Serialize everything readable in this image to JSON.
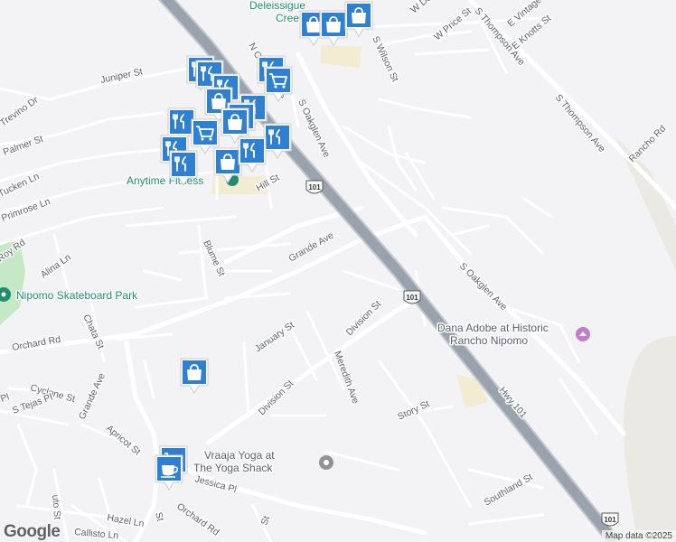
{
  "streets": [
    {
      "id": "n-oakglen",
      "text": "N Oakglen Ave"
    },
    {
      "id": "juniper",
      "text": "Juniper St"
    },
    {
      "id": "trevino",
      "text": "Trevino Dr"
    },
    {
      "id": "palmer",
      "text": "Palmer St"
    },
    {
      "id": "tucken",
      "text": "Tucken Ln"
    },
    {
      "id": "primrose",
      "text": "Primrose Ln"
    },
    {
      "id": "roy",
      "text": "Roy Rd"
    },
    {
      "id": "alina",
      "text": "Alina Ln"
    },
    {
      "id": "blume",
      "text": "Blume St"
    },
    {
      "id": "grande-ave",
      "text": "Grande Ave"
    },
    {
      "id": "hill",
      "text": "Hill St"
    },
    {
      "id": "s-oakglen-top",
      "text": "S Oakglen Ave"
    },
    {
      "id": "s-oakglen-bottom",
      "text": "S Oakglen Ave"
    },
    {
      "id": "orchard",
      "text": "Orchard Rd"
    },
    {
      "id": "orchard-bottom",
      "text": "Orchard Rd"
    },
    {
      "id": "chata",
      "text": "Chata St"
    },
    {
      "id": "january",
      "text": "January St"
    },
    {
      "id": "division-1",
      "text": "Division St"
    },
    {
      "id": "division-2",
      "text": "Division St"
    },
    {
      "id": "meredith",
      "text": "Meredith Ave"
    },
    {
      "id": "story",
      "text": "Story St"
    },
    {
      "id": "cyclone",
      "text": "Cyclone St"
    },
    {
      "id": "s-tejas",
      "text": "S Tejas Pl"
    },
    {
      "id": "grande-sw",
      "text": "Grande Ave"
    },
    {
      "id": "apricot",
      "text": "Apricot St"
    },
    {
      "id": "jessica",
      "text": "Jessica Pl"
    },
    {
      "id": "hazel",
      "text": "Hazel Ln"
    },
    {
      "id": "callisto",
      "text": "Callisto Ln"
    },
    {
      "id": "southland",
      "text": "Southland St"
    },
    {
      "id": "hwy-101",
      "text": "Hwy 101"
    },
    {
      "id": "s-thompson-1",
      "text": "S Thompson Ave"
    },
    {
      "id": "s-thompson-2",
      "text": "S Thompson Ave"
    },
    {
      "id": "rancho",
      "text": "Rancho Rd"
    },
    {
      "id": "e-knotts",
      "text": "E Knotts St"
    },
    {
      "id": "e-vintage",
      "text": "E Vintage St"
    },
    {
      "id": "w-price",
      "text": "W Price St"
    },
    {
      "id": "w-dana",
      "text": "W Dana St"
    },
    {
      "id": "s-wilson",
      "text": "S Wilson St"
    },
    {
      "id": "pl-1",
      "text": "Pl"
    },
    {
      "id": "st-bottom",
      "text": "St"
    },
    {
      "id": "st-bottom2",
      "text": "St"
    },
    {
      "id": "uto",
      "text": "uto St"
    }
  ],
  "places": [
    {
      "id": "skatepark",
      "lines": [
        "Nipomo Skateboard Park"
      ]
    },
    {
      "id": "dana-adobe",
      "lines": [
        "Dana Adobe at Historic",
        "Rancho Nipomo"
      ]
    },
    {
      "id": "vraaja",
      "lines": [
        "Vraaja Yoga at",
        "The Yoga Shack"
      ]
    },
    {
      "id": "anytime",
      "lines": [
        "Anytime Fitness"
      ]
    },
    {
      "id": "deleissig",
      "lines": [
        "Deleissigue",
        "Creek"
      ]
    }
  ],
  "shields": [
    {
      "id": "shield-101-a",
      "text": "101"
    },
    {
      "id": "shield-101-b",
      "text": "101"
    },
    {
      "id": "shield-101-c",
      "text": "101"
    }
  ],
  "markers": [
    {
      "type": "restaurant"
    },
    {
      "type": "restaurant"
    },
    {
      "type": "restaurant"
    },
    {
      "type": "shopping"
    },
    {
      "type": "restaurant"
    },
    {
      "type": "shopping"
    },
    {
      "type": "restaurant"
    },
    {
      "type": "cart"
    },
    {
      "type": "shopping"
    },
    {
      "type": "restaurant"
    },
    {
      "type": "restaurant"
    },
    {
      "type": "cart"
    },
    {
      "type": "restaurant"
    },
    {
      "type": "restaurant"
    },
    {
      "type": "shopping"
    },
    {
      "type": "restaurant"
    },
    {
      "type": "shopping"
    },
    {
      "type": "shopping"
    },
    {
      "type": "shopping"
    },
    {
      "type": "shopping"
    },
    {
      "type": "cart"
    },
    {
      "type": "coffee"
    }
  ],
  "logo": "Google",
  "attribution": "Map data ©2025",
  "colors": {
    "marker_fill": "#2f80d1",
    "marker_icon": "#ffffff",
    "highway": "#9aa3ad",
    "park": "#c5e8c5"
  }
}
